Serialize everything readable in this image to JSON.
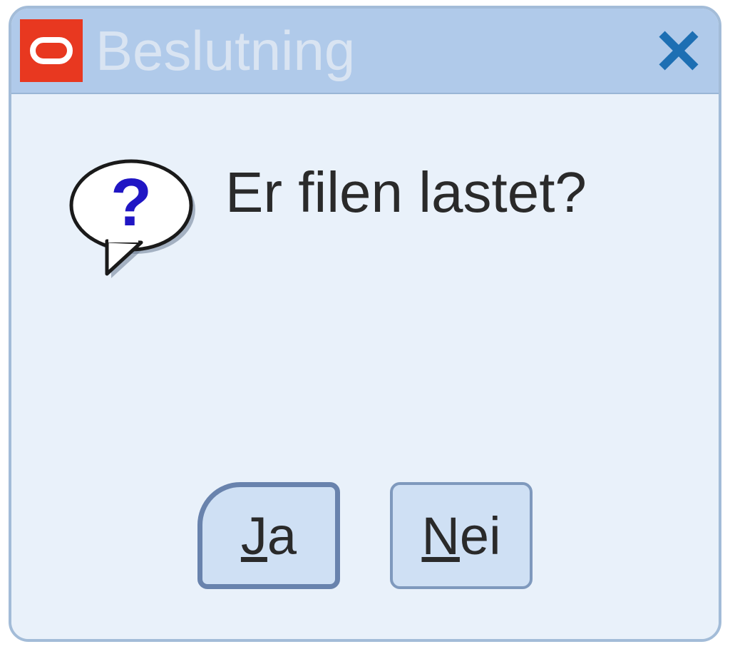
{
  "dialog": {
    "title": "Beslutning",
    "message": "Er filen lastet?",
    "buttons": {
      "yes": {
        "prefix": "J",
        "rest": "a"
      },
      "no": {
        "prefix": "N",
        "rest": "ei"
      }
    }
  },
  "icons": {
    "app": "oracle-icon",
    "close": "close-icon",
    "question": "question-bubble-icon"
  },
  "colors": {
    "titlebar": "#b0caea",
    "body": "#e9f1fa",
    "border": "#a3bcd8",
    "button_bg": "#cfe0f4",
    "button_border": "#7f99bd",
    "accent_red": "#e83820",
    "close_x": "#1d6fb3",
    "question_mark": "#2016c4"
  }
}
